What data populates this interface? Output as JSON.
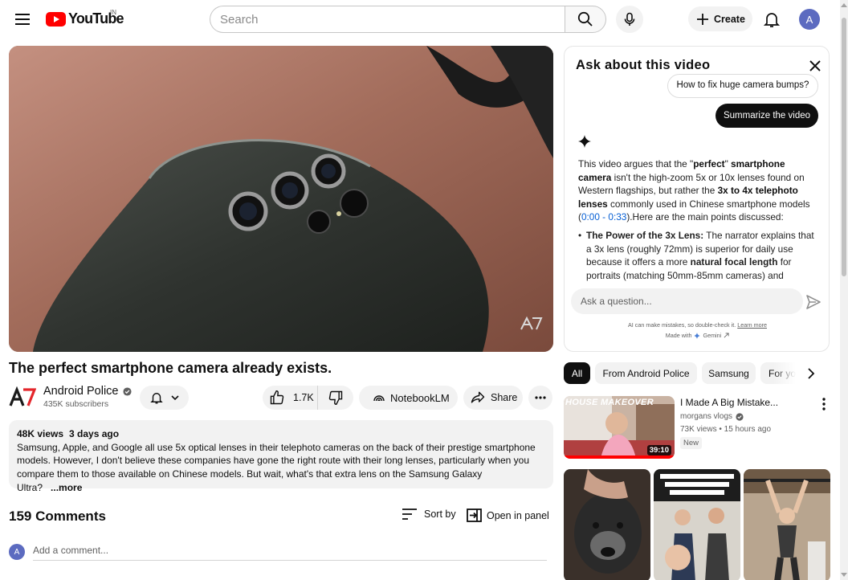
{
  "header": {
    "logo_text": "YouTube",
    "region": "IN",
    "search_placeholder": "Search",
    "create_label": "Create",
    "avatar_letter": "A"
  },
  "video": {
    "title": "The perfect smartphone camera already exists.",
    "watermark": "AP"
  },
  "channel": {
    "name": "Android Police",
    "subscribers": "435K subscribers",
    "logo_text": "AP"
  },
  "actions": {
    "likes": "1.7K",
    "notebook_label": "NotebookLM",
    "share_label": "Share"
  },
  "description": {
    "views": "48K views",
    "age": "3 days ago",
    "text": "Samsung, Apple, and Google all use 5x optical lenses in their telephoto cameras on the back of their prestige smartphone models. However, I don't believe these companies have gone the right route with their long lenses, particularly when you compare them to those available on Chinese models. But wait, what's that extra lens on the Samsung Galaxy Ultra?",
    "more_label": "...more"
  },
  "comments": {
    "count_label": "159 Comments",
    "sort_label": "Sort by",
    "open_panel_label": "Open in panel",
    "add_placeholder": "Add a comment...",
    "avatar_letter": "A"
  },
  "ask_panel": {
    "title": "Ask about this video",
    "prev_chip": "How to fix huge camera bumps?",
    "summarize_chip": "Summarize the video",
    "answer": {
      "t1": "This video argues that the \"",
      "b1": "perfect",
      "t2": "\" ",
      "b2": "smartphone camera",
      "t3": " isn't the high-zoom 5x or 10x lenses found on Western flagships, but rather the ",
      "b3": "3x to 4x telephoto lenses",
      "t4": " commonly used in Chinese smartphone models (",
      "link": "0:00 - 0:33",
      "t5": ").Here are the main points discussed:"
    },
    "bullet": {
      "b1": "The Power of the 3x Lens:",
      "t1": " The narrator explains that a 3x lens (roughly 72mm) is superior for daily use because it offers a more ",
      "b2": "natural focal length",
      "t2": " for portraits (matching 50mm-85mm cameras) and"
    },
    "input_placeholder": "Ask a question...",
    "disclaimer": "AI can make mistakes, so double-check it.",
    "learn_more": "Learn more",
    "made_with": "Made with",
    "gemini": "Gemini"
  },
  "chips": [
    {
      "label": "All",
      "active": true
    },
    {
      "label": "From Android Police",
      "active": false
    },
    {
      "label": "Samsung",
      "active": false
    },
    {
      "label": "For yo",
      "active": false
    }
  ],
  "recommendation": {
    "title": "I Made A Big Mistake...",
    "channel": "morgans vlogs",
    "meta": "73K views • 15 hours ago",
    "badge": "New",
    "duration": "39:10",
    "thumb_caption": "HOUSE MAKEOVER"
  },
  "colors": {
    "brand_red": "#ff0000",
    "link_blue": "#065fd4",
    "chip_bg": "#f2f2f2",
    "text": "#0f0f0f"
  }
}
